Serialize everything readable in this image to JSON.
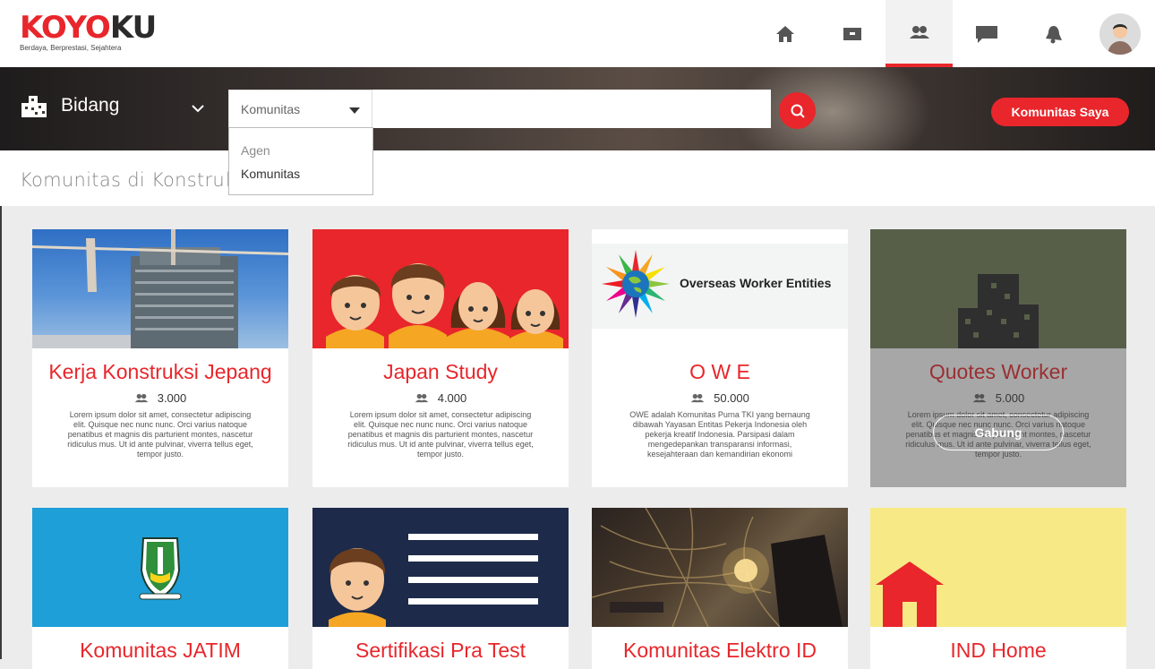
{
  "app": {
    "logo_text_red": "KOYO",
    "logo_text_dark": "KU",
    "tagline": "Berdaya, Berprestasi, Sejahtera"
  },
  "nav": {
    "items": [
      {
        "icon": "home-icon",
        "active": false
      },
      {
        "icon": "card-icon",
        "active": false
      },
      {
        "icon": "community-icon",
        "active": true
      },
      {
        "icon": "chat-icon",
        "active": false
      },
      {
        "icon": "bell-icon",
        "active": false
      }
    ],
    "accent": "#e8262b"
  },
  "search_bar": {
    "category_label": "Bidang",
    "filter_selected": "Komunitas",
    "filter_options": [
      "Agen",
      "Komunitas"
    ],
    "search_value": "",
    "my_communities_label": "Komunitas Saya"
  },
  "section": {
    "heading": "Komunitas di Konstruk"
  },
  "cards": [
    {
      "title": "Kerja Konstruksi Jepang",
      "members": "3.000",
      "desc": "Lorem ipsum dolor sit amet, consectetur adipiscing elit. Quisque nec nunc nunc. Orci varius natoque penatibus et magnis dis parturient montes, nascetur ridiculus mus. Ut id ante pulvinar, viverra tellus eget, tempor justo."
    },
    {
      "title": "Japan Study",
      "members": "4.000",
      "desc": "Lorem ipsum dolor sit amet, consectetur adipiscing elit. Quisque nec nunc nunc. Orci varius natoque penatibus et magnis dis parturient montes, nascetur ridiculus mus. Ut id ante pulvinar, viverra tellus eget, tempor justo."
    },
    {
      "title": "O W E",
      "members": "50.000",
      "image_text": "Overseas Worker Entities",
      "desc": "OWE adalah Komunitas Purna TKI yang bernaung dibawah Yayasan Entitas Pekerja Indonesia oleh pekerja kreatif Indonesia.  Parsipasi dalam mengedepankan transparansi informasi, kesejahteraan dan kemandirian ekonomi"
    },
    {
      "title": "Quotes Worker",
      "members": "5.000",
      "join_label": "Gabung",
      "desc": "Lorem ipsum dolor sit amet, consectetur adipiscing elit. Quisque nec nunc nunc. Orci varius natoque penatibus et magnis dis parturient montes, nascetur ridiculus mus. Ut id ante pulvinar, viverra tellus eget, tempor justo."
    },
    {
      "title": "Komunitas JATIM"
    },
    {
      "title": "Sertifikasi Pra Test"
    },
    {
      "title": "Komunitas Elektro ID"
    },
    {
      "title": "IND Home"
    }
  ],
  "colors": {
    "accent": "#e8262b",
    "japan_study_bg": "#e8262b",
    "quotes_bg": "#6e7c55",
    "jatim_bg": "#1e9fd8",
    "sertifikasi_bg": "#1d2a4a",
    "indhome_bg": "#f7ea86"
  }
}
